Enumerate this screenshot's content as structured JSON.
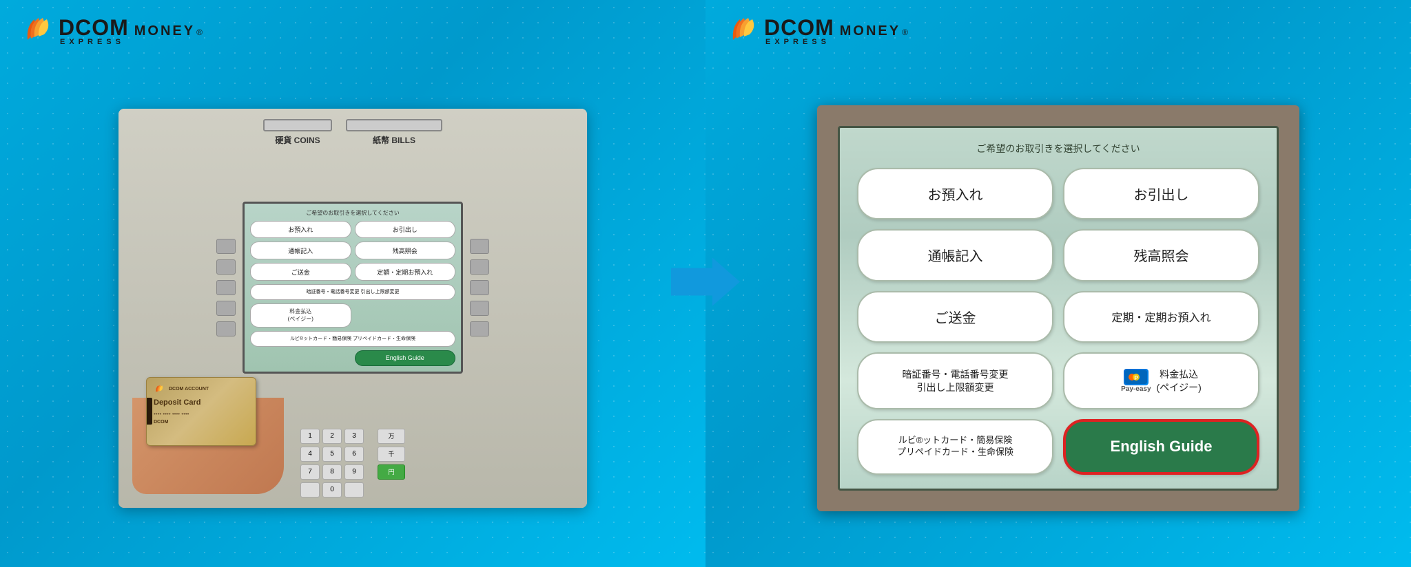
{
  "brand": {
    "name": "DCOM",
    "tagline1": "MONEY",
    "tagline2": "EXPRESS",
    "registered": "®"
  },
  "left_panel": {
    "atm_labels": {
      "coins": "硬貨 COINS",
      "bills": "紙幣 BILLS"
    },
    "screen_header": "ご希望のお取引きを選択してください",
    "buttons": [
      {
        "label": "お預入れ",
        "col": 1
      },
      {
        "label": "お引出し",
        "col": 2
      },
      {
        "label": "通帳記入",
        "col": 1
      },
      {
        "label": "残高照会",
        "col": 2
      },
      {
        "label": "ご送金",
        "col": 1
      },
      {
        "label": "定額・定期お預入れ",
        "col": 2
      },
      {
        "label": "暗証番号・電話番号変更\n引出し上限額変更",
        "col": 1,
        "small": true
      },
      {
        "label": "料金払込\n(ペイジー)",
        "col": 2,
        "pay_easy": true
      },
      {
        "label": "ルビ®ットカード・簡易保険\nプリペイドカード・生命保険",
        "col": 1,
        "small": true
      },
      {
        "label": "English Guide",
        "col": 2,
        "green": true
      }
    ],
    "card": {
      "brand": "DCOM ACCOUNT",
      "title": "Deposit Card",
      "number": "•••• •••• •••• ••••",
      "brand2": "DCOM"
    }
  },
  "right_panel": {
    "screen_header": "ご希望のお取引きを選択してください",
    "buttons": [
      {
        "id": "btn-deposit",
        "label": "お預入れ",
        "type": "normal"
      },
      {
        "id": "btn-withdraw",
        "label": "お引出し",
        "type": "normal"
      },
      {
        "id": "btn-passbook",
        "label": "通帳記入",
        "type": "normal"
      },
      {
        "id": "btn-balance",
        "label": "残高照会",
        "type": "normal"
      },
      {
        "id": "btn-remit",
        "label": "ご送金",
        "type": "normal"
      },
      {
        "id": "btn-fixed",
        "label": "定期・定期お預入れ",
        "type": "normal"
      },
      {
        "id": "btn-pin",
        "label": "暗証番号・電話番号変更\n引出し上限額変更",
        "type": "small"
      },
      {
        "id": "btn-payeasy",
        "label": "料金払込\n(ペイジー)",
        "type": "pay-easy"
      },
      {
        "id": "btn-card",
        "label": "ルビ®ットカード・簡易保険\nプリペイドカード・生命保険",
        "type": "small"
      },
      {
        "id": "btn-english",
        "label": "English Guide",
        "type": "green-highlighted"
      }
    ]
  },
  "arrow": {
    "label": "→",
    "color": "#1199dd"
  }
}
